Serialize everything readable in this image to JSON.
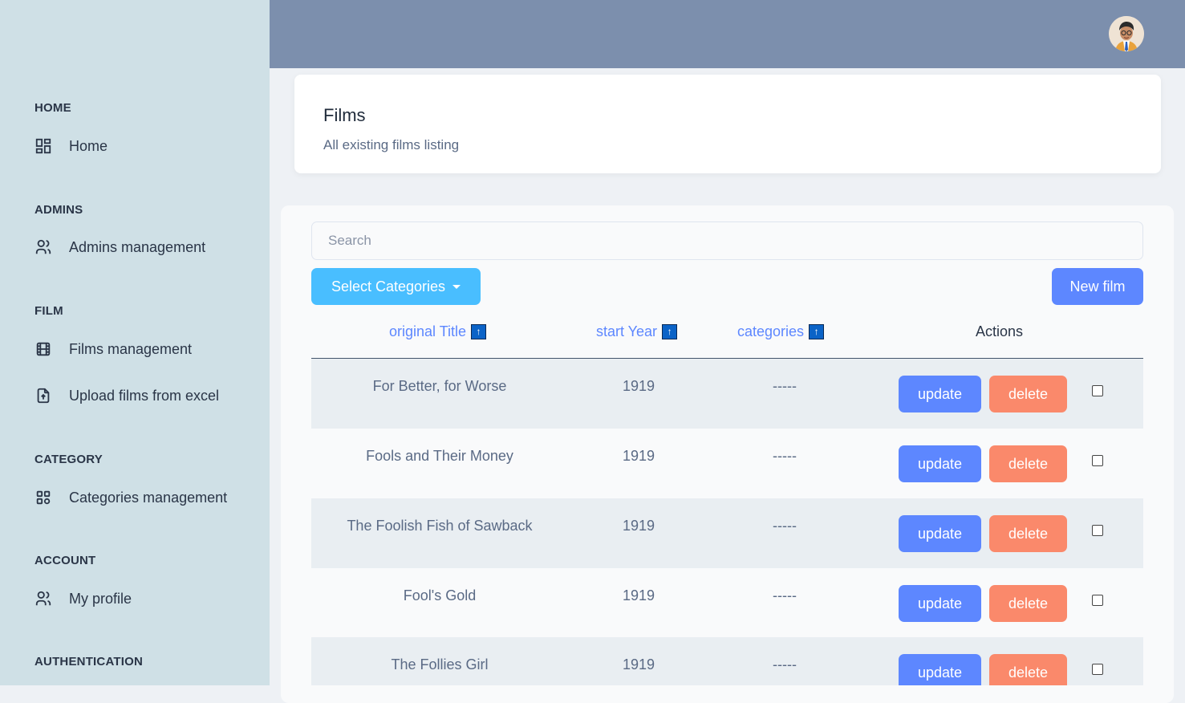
{
  "sidebar": {
    "sections": [
      {
        "heading": "HOME",
        "items": [
          {
            "label": "Home",
            "icon": "layout-dashboard-icon"
          }
        ]
      },
      {
        "heading": "ADMINS",
        "items": [
          {
            "label": "Admins management",
            "icon": "users-icon"
          }
        ]
      },
      {
        "heading": "FILM",
        "items": [
          {
            "label": "Films management",
            "icon": "film-icon"
          },
          {
            "label": "Upload films from excel",
            "icon": "file-upload-icon"
          }
        ]
      },
      {
        "heading": "CATEGORY",
        "items": [
          {
            "label": "Categories management",
            "icon": "category-grid-icon"
          }
        ]
      },
      {
        "heading": "ACCOUNT",
        "items": [
          {
            "label": "My profile",
            "icon": "user-icon"
          }
        ]
      },
      {
        "heading": "AUTHENTICATION",
        "items": []
      }
    ]
  },
  "header": {
    "avatar_icon": "user-avatar"
  },
  "page": {
    "title": "Films",
    "subtitle": "All existing films listing"
  },
  "search": {
    "placeholder": "Search",
    "value": ""
  },
  "toolbar": {
    "select_categories_label": "Select Categories",
    "new_film_label": "New film"
  },
  "table": {
    "columns": [
      {
        "label": "original Title",
        "sortable": true
      },
      {
        "label": "start Year",
        "sortable": true
      },
      {
        "label": "categories",
        "sortable": true
      },
      {
        "label": "Actions",
        "sortable": false
      }
    ],
    "sort_symbol": "↑",
    "rows": [
      {
        "title": "For Better, for Worse",
        "year": "1919",
        "categories": "-----"
      },
      {
        "title": "Fools and Their Money",
        "year": "1919",
        "categories": "-----"
      },
      {
        "title": "The Foolish Fish of Sawback",
        "year": "1919",
        "categories": "-----"
      },
      {
        "title": "Fool's Gold",
        "year": "1919",
        "categories": "-----"
      },
      {
        "title": "The Follies Girl",
        "year": "1919",
        "categories": "-----"
      }
    ],
    "update_label": "update",
    "delete_label": "delete"
  },
  "colors": {
    "sidebar_bg": "#cfe0e6",
    "topbar_bg": "#7c8fad",
    "primary": "#5d87ff",
    "secondary": "#49beff",
    "danger": "#fa896b"
  }
}
